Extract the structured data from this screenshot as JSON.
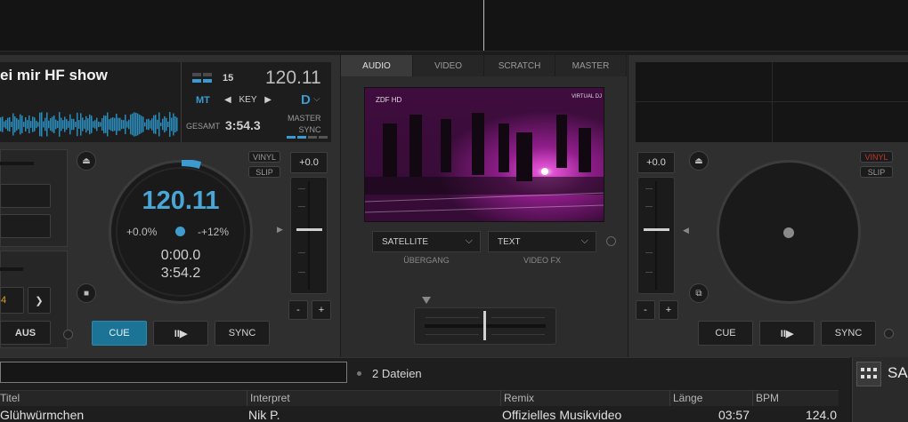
{
  "deck_left": {
    "title": "ei mir HF show",
    "index": "15",
    "bpm": "120.11",
    "mt": "MT",
    "key_label": "KEY",
    "key_prev": "◀",
    "key_next": "▶",
    "key": "D",
    "gesamt_label": "GESAMT",
    "gesamt_value": "3:54.3",
    "master_label": "MASTER",
    "sync_label": "SYNC",
    "vinyl": "VINYL",
    "slip": "SLIP",
    "pitch_value": "+0.0",
    "jog_bpm": "120.11",
    "pitch_minus": "+0.0%",
    "pitch_plus": "-+12%",
    "elapsed": "0:00.0",
    "remain": "3:54.2",
    "cue": "CUE",
    "play": "II▶",
    "sync": "SYNC",
    "aus": "AUS",
    "minus": "-",
    "plus": "+",
    "loop_value": "4",
    "loop_arrow": "❯"
  },
  "center": {
    "tabs": [
      "AUDIO",
      "VIDEO",
      "SCRATCH",
      "MASTER"
    ],
    "transition_value": "SATELLITE",
    "transition_label": "ÜBERGANG",
    "fx_value": "TEXT",
    "fx_label": "VIDEO FX",
    "video_brand": "VIRTUAL DJ",
    "video_channel": "ZDF HD"
  },
  "deck_right": {
    "vinyl": "VINYL",
    "slip": "SLIP",
    "pitch_value": "+0.0",
    "cue": "CUE",
    "play": "II▶",
    "sync": "SYNC",
    "minus": "-",
    "plus": "+"
  },
  "browser": {
    "file_count": "2 Dateien",
    "columns": [
      "Titel",
      "Interpret",
      "Remix",
      "Länge",
      "BPM"
    ],
    "row": {
      "titel": "Glühwürmchen",
      "interpret": "Nik P.",
      "remix": "Offizielles Musikvideo",
      "laenge": "03:57",
      "bpm": "124.0"
    },
    "side_label": "SA"
  },
  "colors": {
    "accent": "#3b9bd0",
    "cue_active": "#1b7395",
    "loop_orange": "#e0a020",
    "vinyl_red": "#c0392b"
  }
}
